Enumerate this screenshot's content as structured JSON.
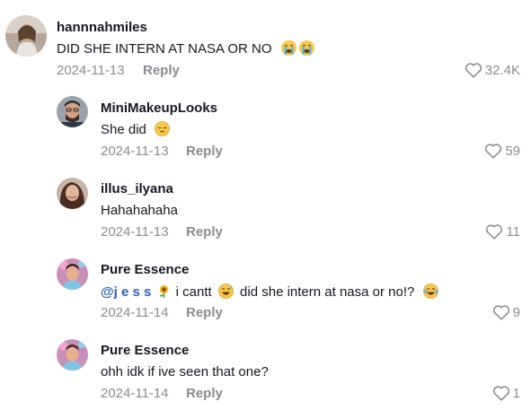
{
  "comments": [
    {
      "username": "hannnahmiles",
      "text": "DID SHE INTERN AT NASA OR NO",
      "emojis": [
        "loudly-crying-face-icon",
        "loudly-crying-face-icon"
      ],
      "date": "2024-11-13",
      "reply": "Reply",
      "likes": "32.4K"
    },
    {
      "username": "MiniMakeupLooks",
      "text": "She did",
      "emojis": [
        "pensive-face-icon"
      ],
      "date": "2024-11-13",
      "reply": "Reply",
      "likes": "59"
    },
    {
      "username": "illus_ilyana",
      "text": "Hahahahaha",
      "date": "2024-11-13",
      "reply": "Reply",
      "likes": "11"
    },
    {
      "username": "Pure Essence",
      "mention": "@j e s s",
      "text_a": "i cantt",
      "text_b": "did she intern at nasa or no!?",
      "emojis": [
        "sunflower-icon",
        "grinning-sweat-face-icon",
        "tears-of-joy-face-icon"
      ],
      "date": "2024-11-14",
      "reply": "Reply",
      "likes": "9"
    },
    {
      "username": "Pure Essence",
      "text": "ohh idk if ive seen that one?",
      "date": "2024-11-14",
      "reply": "Reply",
      "likes": "1"
    }
  ],
  "colors": {
    "text": "#161823",
    "muted": "#8a8b91",
    "mention": "#2b5db9"
  }
}
